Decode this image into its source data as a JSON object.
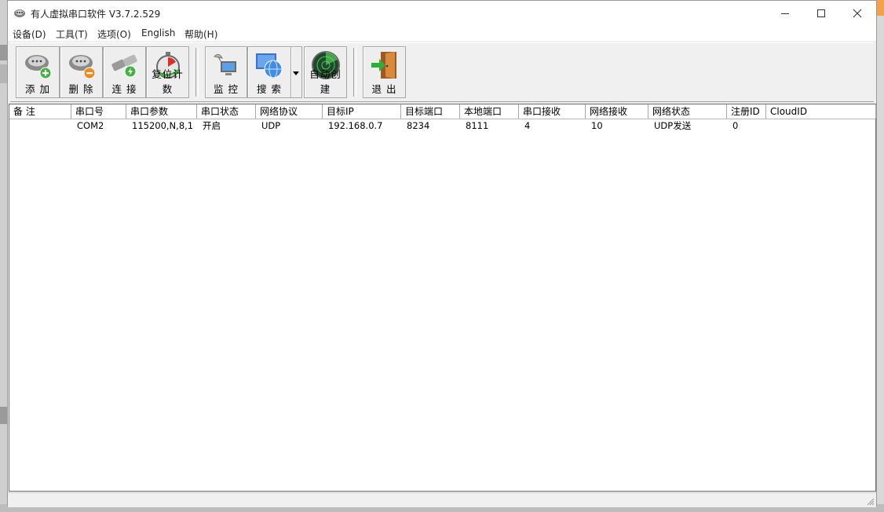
{
  "window": {
    "title": "有人虚拟串口软件 V3.7.2.529",
    "minimize_icon": "minimize-icon",
    "maximize_icon": "maximize-icon",
    "close_icon": "close-icon"
  },
  "menu": [
    {
      "label": "设备(D)"
    },
    {
      "label": "工具(T)"
    },
    {
      "label": "选项(O)"
    },
    {
      "label": "English"
    },
    {
      "label": "帮助(H)"
    }
  ],
  "toolbar": {
    "add": "添 加",
    "delete": "删 除",
    "connect": "连 接",
    "reset_count": "复位计数",
    "monitor": "监 控",
    "search": "搜 索",
    "auto_create": "自动创建",
    "exit": "退 出"
  },
  "table": {
    "columns": [
      "备 注",
      "串口号",
      "串口参数",
      "串口状态",
      "网络协议",
      "目标IP",
      "目标端口",
      "本地端口",
      "串口接收",
      "网络接收",
      "网络状态",
      "注册ID",
      "CloudID"
    ],
    "rows": [
      [
        "",
        "COM2",
        "115200,N,8,1",
        "开启",
        "UDP",
        "192.168.0.7",
        "8234",
        "8111",
        "4",
        "10",
        "UDP发送",
        "0",
        ""
      ]
    ]
  },
  "colors": {
    "titlebar": "#ffffff",
    "window_bg": "#f0f0f0",
    "table_bg": "#ffffff"
  }
}
